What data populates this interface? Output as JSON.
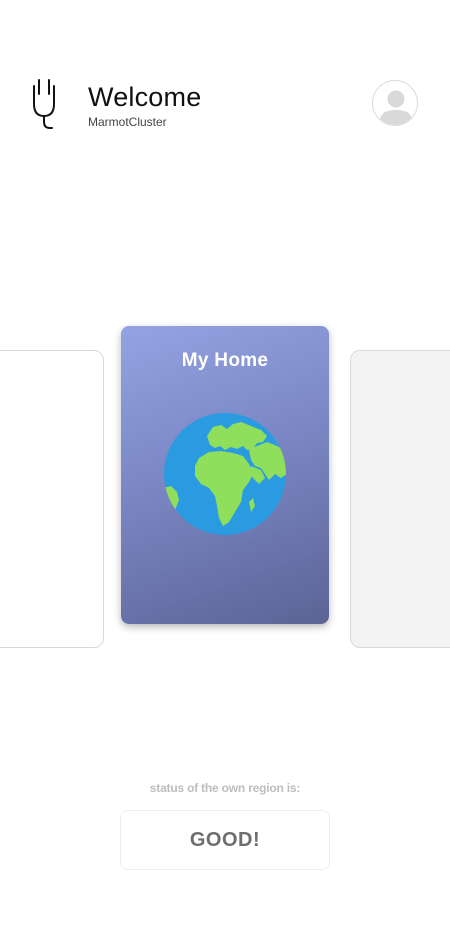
{
  "header": {
    "title": "Welcome",
    "subtitle": "MarmotCluster",
    "logo_icon": "plug-icon",
    "avatar_icon": "user-avatar-icon"
  },
  "carousel": {
    "cards": [
      {
        "label": "",
        "icon": "",
        "state": "inactive-left"
      },
      {
        "label": "My Home",
        "icon": "globe-icon",
        "state": "active"
      },
      {
        "label": "",
        "icon": "",
        "state": "inactive-right"
      }
    ]
  },
  "status": {
    "label": "status of the own region is:",
    "value": "GOOD!"
  },
  "colors": {
    "card_gradient_start": "#93a3e3",
    "card_gradient_end": "#5c6496",
    "globe_ocean": "#2a9be0",
    "globe_land": "#8fdf5c",
    "status_text": "#6e6e6e"
  }
}
